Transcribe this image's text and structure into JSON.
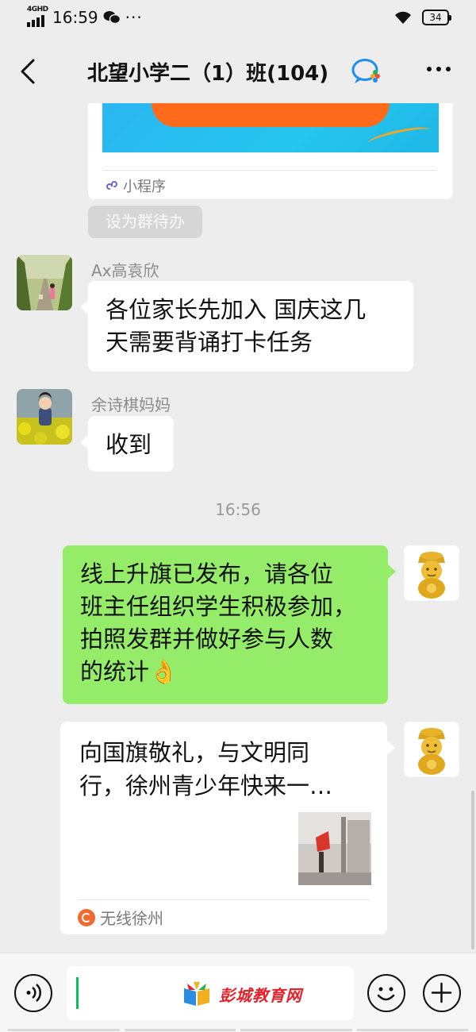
{
  "status_bar": {
    "network": "4GHD",
    "time": "16:59",
    "more": "···",
    "battery": "34"
  },
  "header": {
    "title": "北望小学二（1）班(104)"
  },
  "mini_program_card": {
    "label": "小程序"
  },
  "todo_button": {
    "label": "设为群待办"
  },
  "messages": [
    {
      "sender": "Ax高袁欣",
      "lines": [
        "各位家长先加入 国庆这几",
        "天需要背诵打卡任务"
      ]
    },
    {
      "sender": "余诗棋妈妈",
      "lines": [
        "收到"
      ]
    }
  ],
  "timestamp": "16:56",
  "own_message": {
    "lines": [
      "线上升旗已发布，请各位",
      "班主任组织学生积极参加，",
      "拍照发群并做好参与人数",
      "的统计👌"
    ]
  },
  "article": {
    "title_lines": [
      "向国旗敬礼，与文明同",
      "行，徐州青少年快来一…"
    ],
    "source": "无线徐州"
  },
  "input_bar": {
    "watermark": "彭城教育网"
  },
  "colors": {
    "own_bubble": "#95ec69",
    "background": "#ededed",
    "caret": "#07c160",
    "watermark": "#e8202a"
  }
}
